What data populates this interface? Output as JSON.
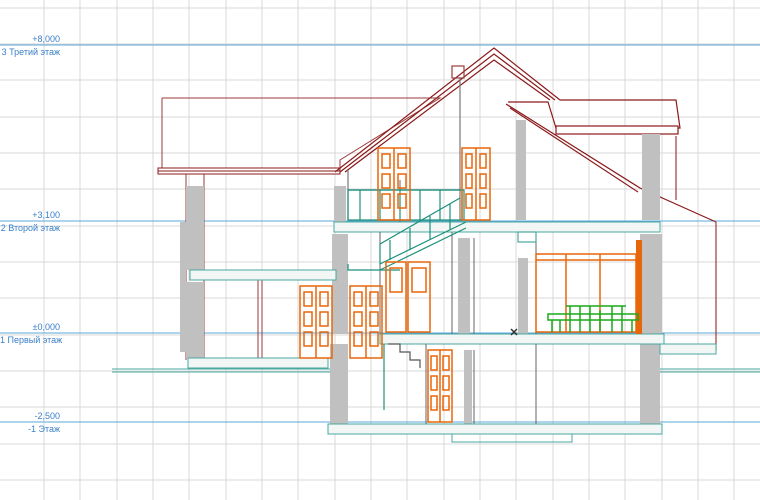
{
  "levels": [
    {
      "value": "+8,000",
      "name": "3 Третий этаж"
    },
    {
      "value": "+3,100",
      "name": "2 Второй этаж"
    },
    {
      "value": "±0,000",
      "name": "1 Первый этаж"
    },
    {
      "value": "-2,500",
      "name": "-1 Этаж"
    }
  ],
  "colors": {
    "grid": "#d8d8d8",
    "level_line": "#5aa8d8",
    "roof": "#8b1a1a",
    "wall_outline": "#9b3a3a",
    "door": "#e8660a",
    "furniture": "#1aa81a",
    "stairs": "#1a8f7a",
    "concrete": "#c0c0c0",
    "slab_edge": "#4aa8a0"
  }
}
